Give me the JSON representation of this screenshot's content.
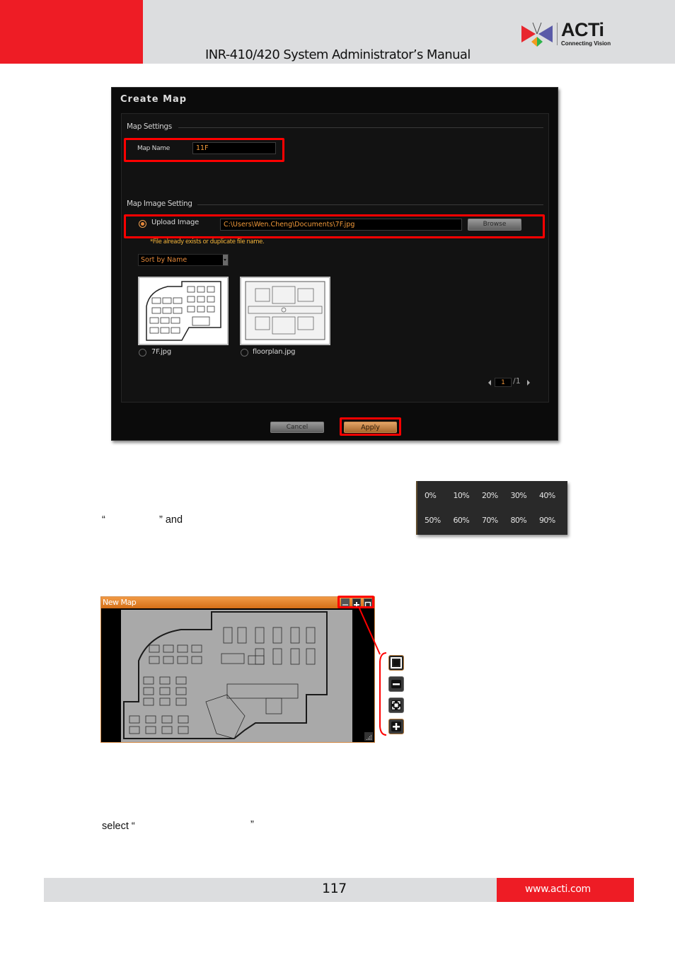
{
  "header": {
    "title": "INR-410/420 System Administrator’s Manual",
    "logo": {
      "wordmark": "ACTi",
      "tagline": "Connecting Vision",
      "colors": {
        "red": "#e8262e",
        "blue": "#5a5aa8",
        "orange": "#f39a1e",
        "green": "#2db34a"
      }
    },
    "accent_color": "#ee1c25"
  },
  "create_map_dialog": {
    "title": "Create Map",
    "map_settings": {
      "section_label": "Map Settings",
      "map_name_label": "Map Name",
      "map_name_value": "11F"
    },
    "map_image_setting": {
      "section_label": "Map Image Setting",
      "upload_option_label": "Upload Image",
      "upload_selected": true,
      "file_path_value": "C:\\Users\\Wen.Cheng\\Documents\\7F.jpg",
      "browse_label": "Browse",
      "warning_text": "*File already exists or duplicate file name.",
      "sort_select_value": "Sort by Name",
      "thumbnails": [
        {
          "filename": "7F.jpg",
          "selected": false
        },
        {
          "filename": "floorplan.jpg",
          "selected": false
        }
      ],
      "pager": {
        "current": "1",
        "total_label": "/1"
      }
    },
    "buttons": {
      "cancel": "Cancel",
      "apply": "Apply"
    }
  },
  "opacity_menu": {
    "options": [
      "0%",
      "10%",
      "20%",
      "30%",
      "40%",
      "50%",
      "60%",
      "70%",
      "80%",
      "90%"
    ]
  },
  "body_text": {
    "fragment_1_open_quote": "“",
    "fragment_1_close": "” and",
    "fragment_2": "select “",
    "fragment_2_close": "”"
  },
  "new_map_window": {
    "title": "New Map",
    "titlebar_buttons": [
      "zoom-out",
      "zoom-in",
      "fit"
    ],
    "side_legend_icons": [
      "fit-window",
      "zoom-out",
      "actual-size",
      "zoom-in"
    ],
    "titlebar_color": "#e8832a"
  },
  "footer": {
    "page_number": "117",
    "url": "www.acti.com"
  },
  "highlight_color": "#ff0000"
}
